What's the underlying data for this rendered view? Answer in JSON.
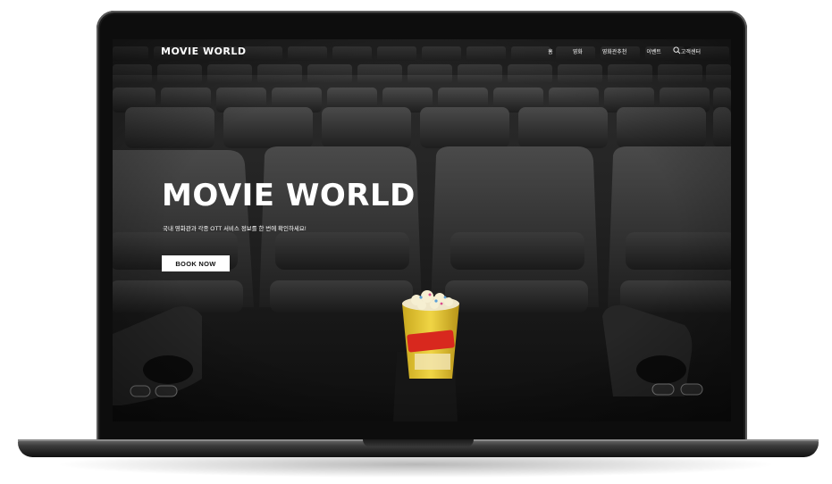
{
  "site": {
    "logo_text": "MOVIE WORLD",
    "nav": {
      "items": [
        {
          "label": "홈"
        },
        {
          "label": "영화"
        },
        {
          "label": "영화관추천"
        },
        {
          "label": "이벤트"
        },
        {
          "label": "고객센터"
        }
      ],
      "search_icon": "search-icon"
    },
    "hero": {
      "title": "MOVIE WORLD",
      "subtitle": "국내 영화관과 각종 OTT 서비스 정보를 한 번에 확인하세요!",
      "cta_label": "BOOK NOW",
      "image_description_icon": "cinema-seats-popcorn-image"
    }
  },
  "colors": {
    "hero_text": "#ffffff",
    "button_bg": "#ffffff",
    "button_text": "#111111",
    "laptop_frame": "#0d0d0d"
  }
}
